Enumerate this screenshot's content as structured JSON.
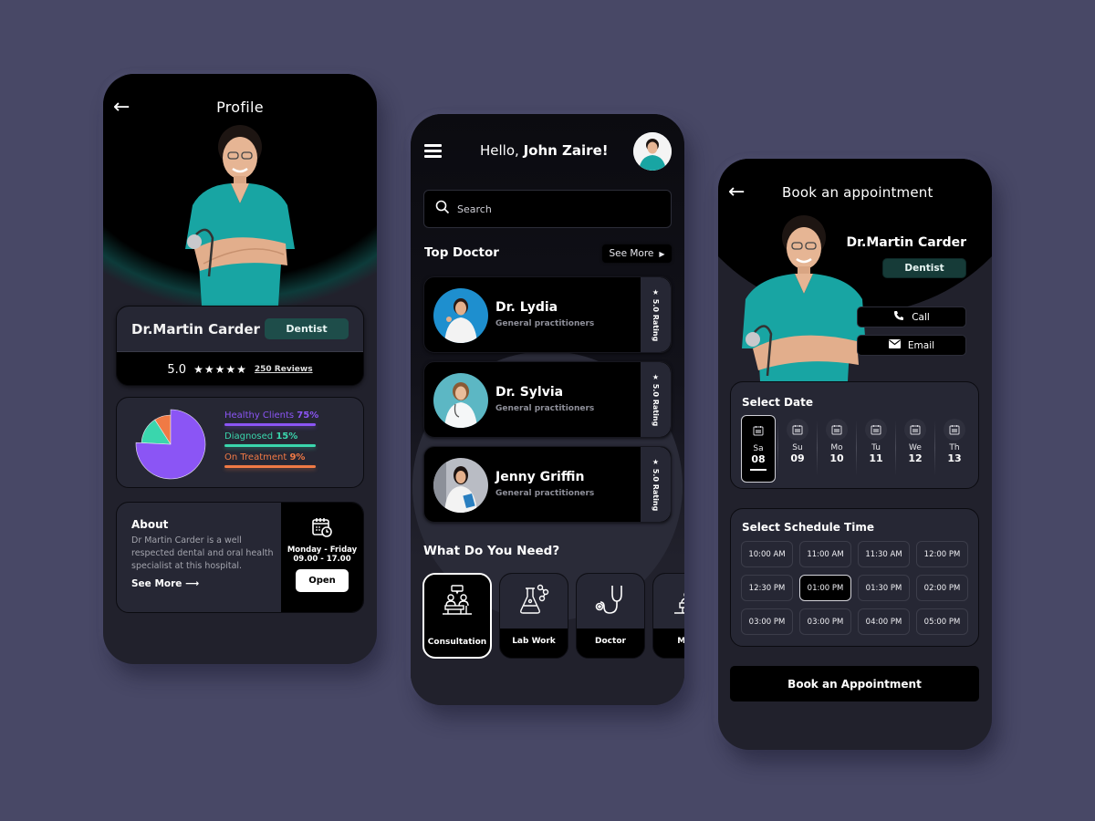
{
  "colors": {
    "background": "#484866",
    "card": "#262734",
    "teal_badge": "#1e4d4a",
    "purple": "#7a3cf0",
    "teal": "#3ad6ad",
    "orange": "#f07a45"
  },
  "profile_screen": {
    "title": "Profile",
    "back_icon": "arrow-left-icon",
    "doctor_name": "Dr.Martin Carder",
    "specialty": "Dentist",
    "rating": "5.0",
    "stars": "★★★★★",
    "reviews": "250 Reviews",
    "stats": [
      {
        "label": "Healthy Clients",
        "value": "75%",
        "percent": 75,
        "color": "#8b55f5"
      },
      {
        "label": "Diagnosed",
        "value": "15%",
        "percent": 15,
        "color": "#3ad6ad"
      },
      {
        "label": "On Treatment",
        "value": "9%",
        "percent": 9,
        "color": "#f07a45"
      }
    ],
    "about": {
      "title": "About",
      "text": "Dr Martin Carder is a well respected dental and oral health specialist at this hospital.",
      "see_more": "See More ⟶",
      "calendar_icon": "calendar-clock-icon",
      "days": "Monday - Friday",
      "hours": "09.00 - 17.00",
      "status_button": "Open"
    }
  },
  "home_screen": {
    "greeting_prefix": "Hello, ",
    "user_name": "John Zaire!",
    "menu_icon": "hamburger-icon",
    "search_placeholder": "Search",
    "top_doctor_title": "Top Doctor",
    "see_more": "See More",
    "doctors": [
      {
        "name": "Dr. Lydia",
        "specialty": "General practitioners",
        "rating": "★ 5.0 Rating"
      },
      {
        "name": "Dr. Sylvia",
        "specialty": "General practitioners",
        "rating": "★ 5.0 Rating"
      },
      {
        "name": "Jenny Griffin",
        "specialty": "General practitioners",
        "rating": "★ 5.0 Rating"
      }
    ],
    "needs_title": "What Do You Need?",
    "services": [
      {
        "label": "Consultation",
        "icon": "consultation-icon",
        "active": true
      },
      {
        "label": "Lab Work",
        "icon": "flask-icon",
        "active": false
      },
      {
        "label": "Doctor",
        "icon": "stethoscope-icon",
        "active": false
      },
      {
        "label": "Med",
        "icon": "medicine-icon",
        "active": false
      }
    ]
  },
  "booking_screen": {
    "title": "Book an appointment",
    "doctor_name": "Dr.Martin Carder",
    "specialty": "Dentist",
    "call_label": "Call",
    "email_label": "Email",
    "select_date_title": "Select Date",
    "dates": [
      {
        "day": "Sa",
        "num": "08",
        "selected": true
      },
      {
        "day": "Su",
        "num": "09",
        "selected": false
      },
      {
        "day": "Mo",
        "num": "10",
        "selected": false
      },
      {
        "day": "Tu",
        "num": "11",
        "selected": false
      },
      {
        "day": "We",
        "num": "12",
        "selected": false
      },
      {
        "day": "Th",
        "num": "13",
        "selected": false
      }
    ],
    "select_time_title": "Select Schedule Time",
    "times": [
      {
        "label": "10:00 AM",
        "selected": false
      },
      {
        "label": "11:00 AM",
        "selected": false
      },
      {
        "label": "11:30 AM",
        "selected": false
      },
      {
        "label": "12:00 PM",
        "selected": false
      },
      {
        "label": "12:30 PM",
        "selected": false
      },
      {
        "label": "01:00 PM",
        "selected": true
      },
      {
        "label": "01:30 PM",
        "selected": false
      },
      {
        "label": "02:00 PM",
        "selected": false
      },
      {
        "label": "03:00 PM",
        "selected": false
      },
      {
        "label": "03:00 PM",
        "selected": false
      },
      {
        "label": "04:00 PM",
        "selected": false
      },
      {
        "label": "05:00 PM",
        "selected": false
      }
    ],
    "book_button": "Book an Appointment"
  }
}
